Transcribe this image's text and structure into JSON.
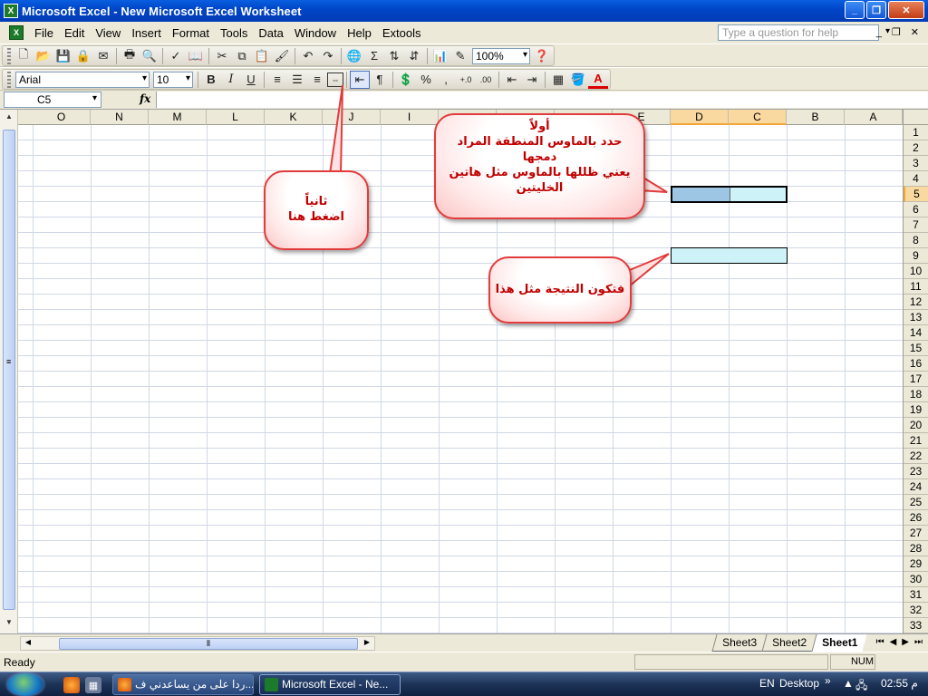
{
  "window": {
    "title": "Microsoft Excel - New Microsoft Excel Worksheet"
  },
  "menu": {
    "items": [
      "File",
      "Edit",
      "View",
      "Insert",
      "Format",
      "Tools",
      "Data",
      "Window",
      "Help",
      "Extools"
    ],
    "help_placeholder": "Type a question for help"
  },
  "toolbar": {
    "zoom": "100%",
    "font": "Arial",
    "size": "10"
  },
  "formula": {
    "name_box": "C5",
    "fx": "fx"
  },
  "sheet": {
    "columns": [
      "O",
      "N",
      "M",
      "L",
      "K",
      "J",
      "I",
      "",
      "",
      "",
      "E",
      "D",
      "C",
      "B",
      "A"
    ],
    "rows": [
      "1",
      "2",
      "3",
      "4",
      "5",
      "6",
      "7",
      "8",
      "9",
      "10",
      "11",
      "12",
      "13",
      "14",
      "15",
      "16",
      "17",
      "18",
      "19",
      "20",
      "21",
      "22",
      "23",
      "24",
      "25",
      "26",
      "27",
      "28",
      "29",
      "30",
      "31",
      "32",
      "33"
    ],
    "selected_columns": [
      "D",
      "C"
    ],
    "selected_row": "5"
  },
  "callouts": {
    "first": {
      "line1": "أولاً",
      "line2": "حدد بالماوس المنطقة المراد",
      "line3": "دمجها",
      "line4": "يعني ظللها بالماوس مثل هاتين",
      "line5": "الخليتين"
    },
    "second": {
      "line1": "ثانياً",
      "line2": "اضغط هنا"
    },
    "third": {
      "line1": "فتكون النتيجة مثل هذا"
    }
  },
  "tabs": [
    "Sheet3",
    "Sheet2",
    "Sheet1"
  ],
  "status": {
    "text": "Ready",
    "num": "NUM"
  },
  "taskbar": {
    "tasks": [
      "ردا على من يساعدني ف...",
      "Microsoft Excel - Ne..."
    ],
    "lang": "EN",
    "desktop": "Desktop",
    "clock": "02:55 م"
  },
  "colors": {
    "callout_border": "#e23b3b",
    "callout_text": "#c00000",
    "selection_fill": "#9cc6e4",
    "merged_fill": "#cdf2f8"
  }
}
